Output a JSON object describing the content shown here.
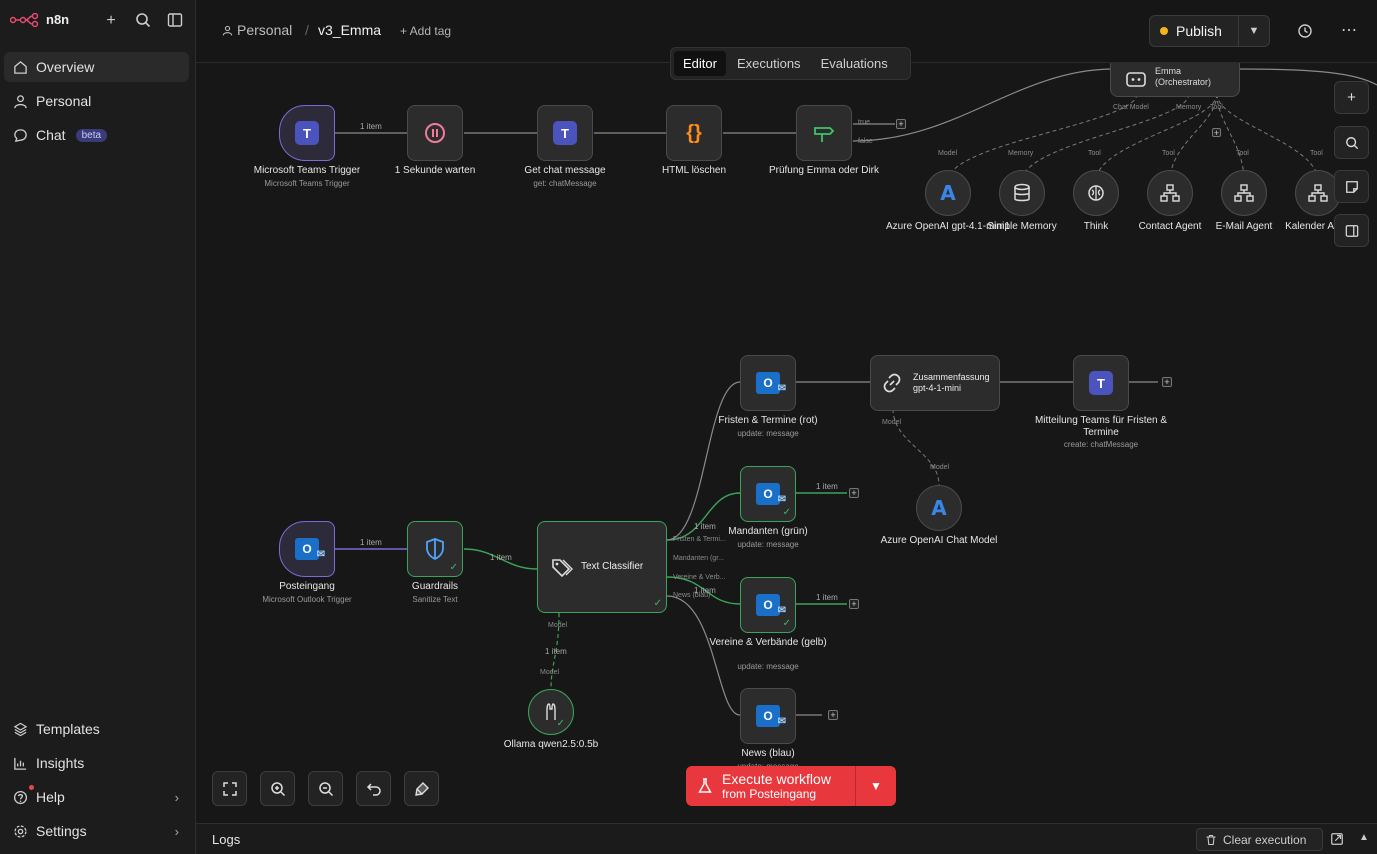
{
  "app": {
    "name": "n8n"
  },
  "sidebar": {
    "items": [
      {
        "label": "Overview",
        "icon": "home-icon"
      },
      {
        "label": "Personal",
        "icon": "user-icon"
      },
      {
        "label": "Chat",
        "icon": "chat-icon",
        "badge": "beta"
      }
    ],
    "bottom": [
      {
        "label": "Templates",
        "icon": "templates-icon"
      },
      {
        "label": "Insights",
        "icon": "insights-icon"
      },
      {
        "label": "Help",
        "icon": "help-icon"
      },
      {
        "label": "Settings",
        "icon": "settings-icon"
      }
    ]
  },
  "header": {
    "project": "Personal",
    "separator": "/",
    "workflow_name": "v3_Emma",
    "add_tag": "+ Add tag",
    "publish": "Publish"
  },
  "tabs": [
    "Editor",
    "Executions",
    "Evaluations"
  ],
  "nodes": {
    "teams_trigger": {
      "label": "Microsoft Teams Trigger",
      "sub": "Microsoft Teams Trigger"
    },
    "wait": {
      "label": "1 Sekunde warten"
    },
    "get_chat": {
      "label": "Get chat message",
      "sub": "get: chatMessage"
    },
    "html": {
      "label": "HTML löschen"
    },
    "pruefung": {
      "label": "Prüfung Emma oder Dirk"
    },
    "orchestrator": {
      "label": "Emma (Orchestrator)"
    },
    "azure1": {
      "label": "Azure OpenAI gpt-4.1-mini1"
    },
    "memory": {
      "label": "Simple Memory"
    },
    "think": {
      "label": "Think"
    },
    "contact": {
      "label": "Contact Agent"
    },
    "email": {
      "label": "E-Mail Agent"
    },
    "kalender": {
      "label": "Kalender A"
    },
    "posteingang": {
      "label": "Posteingang",
      "sub": "Microsoft Outlook Trigger"
    },
    "guardrails": {
      "label": "Guardrails",
      "sub": "Sanitize Text"
    },
    "classifier": {
      "label": "Text Classifier"
    },
    "ollama": {
      "label": "Ollama qwen2.5:0.5b"
    },
    "fristen": {
      "label": "Fristen & Termine (rot)",
      "sub": "update: message"
    },
    "mandanten": {
      "label": "Mandanten (grün)",
      "sub": "update: message"
    },
    "vereine": {
      "label": "Vereine & Verbände (gelb)",
      "sub": "update: message"
    },
    "news": {
      "label": "News (blau)",
      "sub": "update: message"
    },
    "zusammen": {
      "label": "Zusammenfassung gpt-4-1-mini"
    },
    "mitteilung": {
      "label": "Mitteilung Teams für Fristen & Termine",
      "sub": "create: chatMessage"
    },
    "azure_chat": {
      "label": "Azure OpenAI Chat Model"
    }
  },
  "labels": {
    "one_item": "1 item",
    "true": "true",
    "false": "false",
    "chat_model": "Chat Model",
    "memory": "Memory",
    "tool": "Tool",
    "model": "Model",
    "port_fristen": "Fristen & Termi...",
    "port_mandanten": "Mandanten (gr...",
    "port_vereine": "Vereine & Verb...",
    "port_news": "News (blau)"
  },
  "execute": {
    "title": "Execute workflow",
    "sub": "from Posteingang"
  },
  "logs": {
    "title": "Logs",
    "clear": "Clear execution"
  },
  "colors": {
    "accent": "#e8383d",
    "success": "#3fb56a",
    "trigger": "#7b6bd9",
    "publish_dot": "#f5b51c"
  }
}
